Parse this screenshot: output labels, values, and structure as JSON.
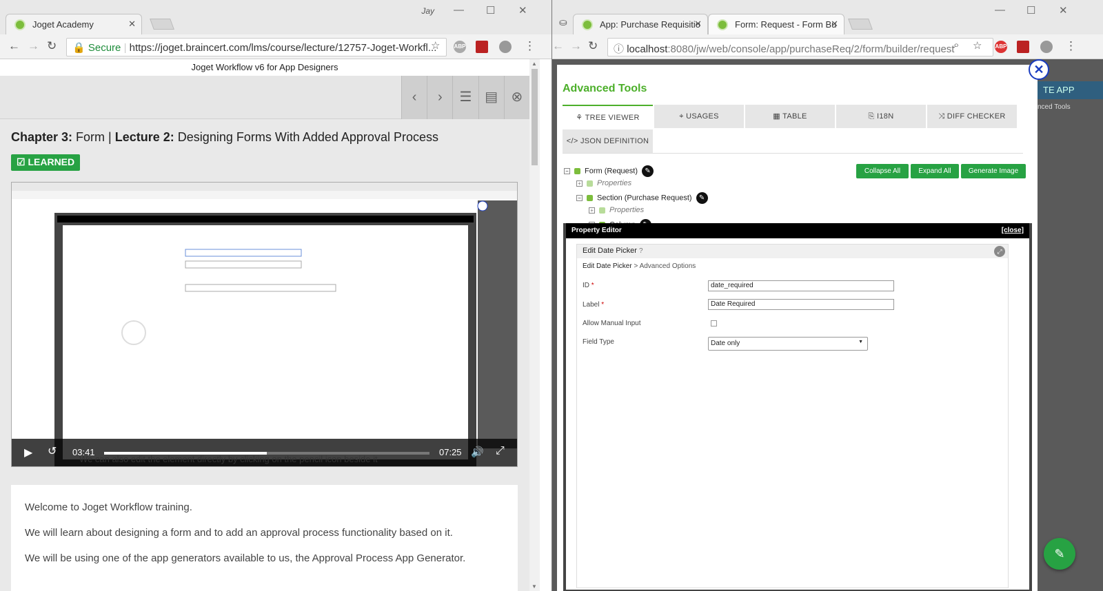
{
  "left_window": {
    "user_name": "Jay",
    "tab_title": "Joget Academy",
    "url_secure_label": "Secure",
    "url": "https://joget.braincert.com/lms/course/lecture/12757-Joget-Workfl...",
    "course_title": "Joget Workflow v6 for App Designers",
    "chapter_label": "Chapter 3:",
    "chapter_name": "Form",
    "separator": "|",
    "lecture_label": "Lecture 2:",
    "lecture_name": "Designing Forms With Added Approval Process",
    "learned_badge": "LEARNED",
    "video": {
      "current_time": "03:41",
      "total_time": "07:25",
      "progress": 0.5,
      "caption": "We can also edit the element directly by clicking on the pencil icon beside it"
    },
    "paragraphs": [
      "Welcome to Joget Workflow training.",
      "We will learn about designing a form and to add an approval process functionality based on it.",
      "We will be using one of the app generators available to us, the Approval Process App Generator."
    ]
  },
  "right_window": {
    "tabs": [
      {
        "title": "App: Purchase Requisitio"
      },
      {
        "title": "Form: Request - Form Bu"
      }
    ],
    "url_host": "localhost",
    "url_path": ":8080/jw/web/console/app/purchaseReq/2/form/builder/request",
    "extension_abp": "ABP",
    "background_button": "TE APP",
    "background_label": "nced Tools",
    "advanced_tools_title": "Advanced Tools",
    "tool_tabs": [
      "TREE VIEWER",
      "USAGES",
      "TABLE",
      "I18N",
      "DIFF CHECKER",
      "JSON DEFINITION"
    ],
    "tree": {
      "form": "Form (Request)",
      "form_properties": "Properties",
      "section": "Section (Purchase Request)",
      "section_properties": "Properties",
      "column": "Column"
    },
    "buttons": {
      "collapse_all": "Collapse All",
      "expand_all": "Expand All",
      "generate_image": "Generate Image"
    },
    "property_editor": {
      "title": "Property Editor",
      "close": "[close]",
      "heading": "Edit Date Picker",
      "breadcrumb_main": "Edit Date Picker",
      "breadcrumb_sep": ">",
      "breadcrumb_sub": "Advanced Options",
      "fields": {
        "id_label": "ID",
        "id_value": "date_required",
        "label_label": "Label",
        "label_value": "Date Required",
        "manual_label": "Allow Manual Input",
        "field_type_label": "Field Type",
        "field_type_value": "Date only"
      }
    }
  }
}
